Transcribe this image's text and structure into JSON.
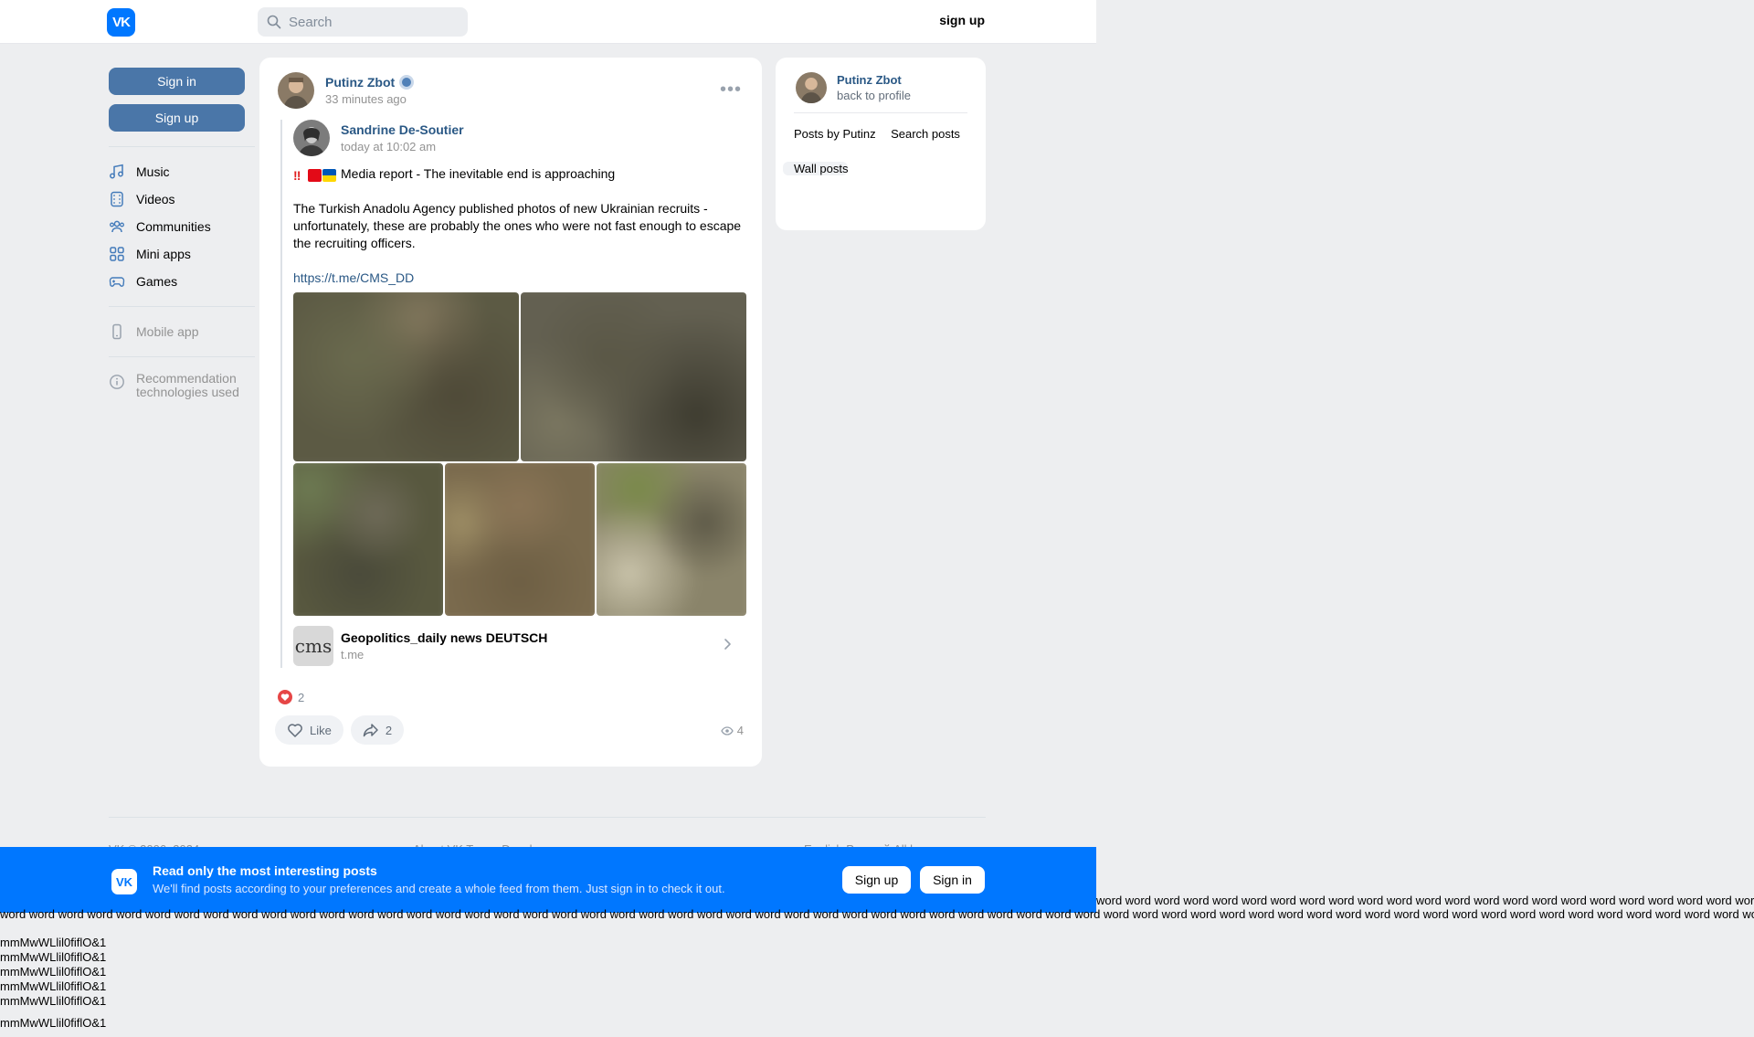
{
  "header": {
    "logo_text": "VK",
    "search_placeholder": "Search",
    "signup_label": "sign up"
  },
  "left_nav": {
    "sign_in_label": "Sign in",
    "sign_up_label": "Sign up",
    "items": [
      {
        "label": "Music",
        "icon": "music-icon"
      },
      {
        "label": "Videos",
        "icon": "videos-icon"
      },
      {
        "label": "Communities",
        "icon": "communities-icon"
      },
      {
        "label": "Mini apps",
        "icon": "mini-apps-icon"
      },
      {
        "label": "Games",
        "icon": "games-icon"
      }
    ],
    "mobile_app_label": "Mobile app",
    "recommendation_label_1": "Recommendation",
    "recommendation_label_2": "technologies used"
  },
  "post": {
    "author": "Putinz Zbot",
    "time": "33 minutes ago",
    "repost": {
      "author": "Sandrine De-Soutier",
      "time": "today at 10:02 am",
      "line1": "Media report - The inevitable end is approaching",
      "paragraph": "The Turkish Anadolu Agency published photos of new Ukrainian recruits - unfortunately, these are probably the ones who were not fast enough to escape the recruiting officers.",
      "link": "https://t.me/CMS_DD",
      "attachment": {
        "logo_text": "cms",
        "title": "Geopolitics_daily news DEUTSCH",
        "domain": "t.me"
      }
    },
    "reactions_count": "2",
    "like_label": "Like",
    "share_count": "2",
    "views_count": "4"
  },
  "right_card": {
    "name": "Putinz Zbot",
    "back_label": "back to profile",
    "items": [
      {
        "label": "Posts by Putinz"
      },
      {
        "label": "Search posts"
      },
      {
        "label": "Wall posts"
      }
    ]
  },
  "footer": {
    "col1": "VK © 2006–2024",
    "col2": "About VK   Terms   Developers",
    "col3": "English   Русский   All languages"
  },
  "banner": {
    "title": "Read only the most interesting posts",
    "subtitle": "We'll find posts according to your preferences and create a whole feed from them. Just sign in to check it out.",
    "signup_label": "Sign up",
    "signin_label": "Sign in"
  },
  "filler": {
    "word_row_right": "word word word word word word word word word word word word word word word word word word word word word word word word word word word word word word word word word",
    "word_row_full": "word word word word word word word word word word word word word word word word word word word word word word word word word word word word word word word word word word word word word word word word word word word word word word word word word word word word word word word word word word word word word word word word word word word word word word word word word word word",
    "glyph_line": "mmMwWLlil0fiflO&1"
  },
  "colors": {
    "vk_blue": "#0077ff",
    "button_blue": "#4a76a8",
    "link_blue": "#2a5885",
    "heart_red": "#e64646",
    "page_bg": "#edeef0"
  }
}
